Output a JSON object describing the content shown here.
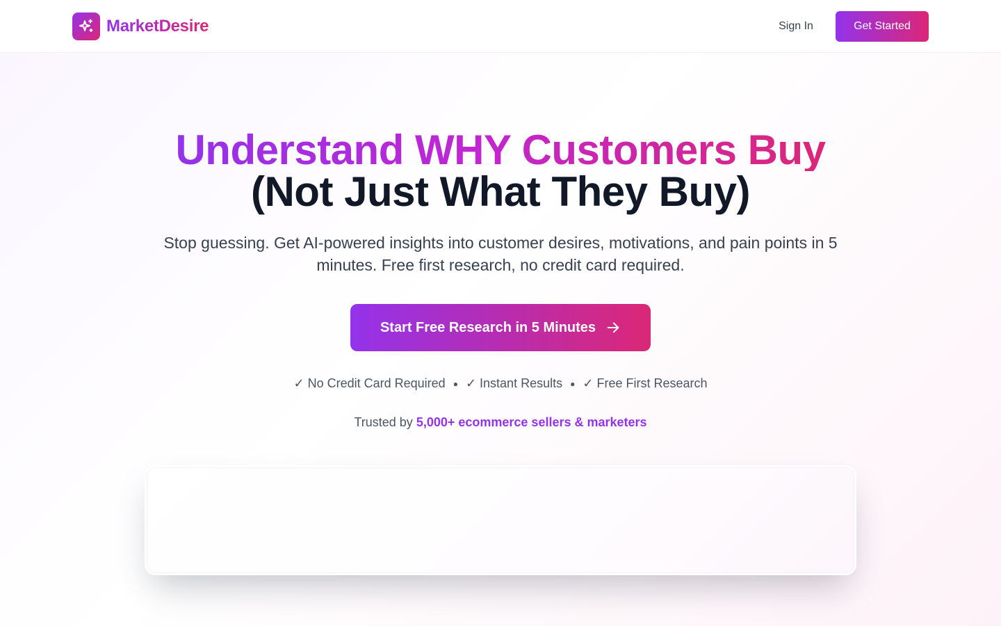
{
  "header": {
    "brand_name": "MarketDesire",
    "logo_icon": "sparkles-icon",
    "signin_label": "Sign In",
    "cta_label": "Get Started"
  },
  "hero": {
    "title_line_1": "Understand WHY Customers Buy",
    "title_line_2": "(Not Just What They Buy)",
    "subtitle": "Stop guessing. Get AI-powered insights into customer desires, motivations, and pain points in 5 minutes. Free first research, no credit card required.",
    "cta_label": "Start Free Research in 5 Minutes",
    "cta_icon": "arrow-right-icon",
    "benefits": [
      "✓ No Credit Card Required",
      "✓ Instant Results",
      "✓ Free First Research"
    ],
    "benefit_separator": "●",
    "trusted_prefix": "Trusted by ",
    "trusted_highlight": "5,000+ ecommerce sellers & marketers"
  },
  "colors": {
    "brand_start": "#9333ea",
    "brand_end": "#db2777",
    "heading": "#111827",
    "body_text": "#374151"
  }
}
